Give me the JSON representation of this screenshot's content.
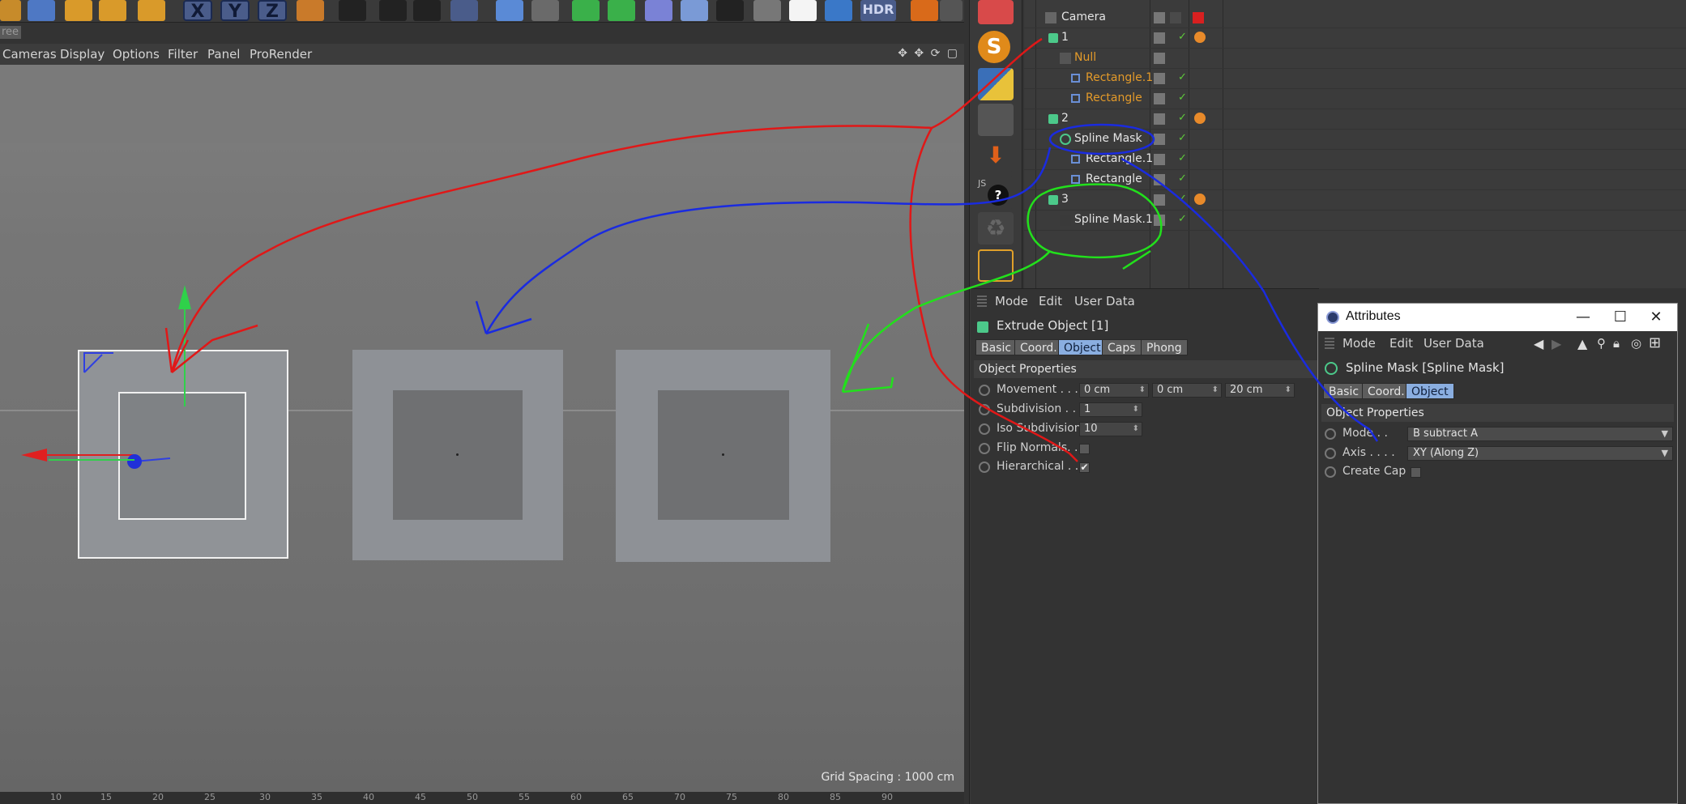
{
  "toolbar": {
    "xyz": [
      "X",
      "Y",
      "Z"
    ],
    "hdr_label": "HDR"
  },
  "tree_tab": "ree",
  "viewport": {
    "menu": [
      "Cameras",
      "Display",
      "Options",
      "Filter",
      "Panel",
      "ProRender"
    ],
    "grid_spacing": "Grid Spacing : 1000 cm",
    "ruler_ticks": [
      "10",
      "15",
      "20",
      "25",
      "30",
      "35",
      "40",
      "45",
      "50",
      "55",
      "60",
      "65",
      "70",
      "75",
      "80",
      "85",
      "90"
    ]
  },
  "palette": {
    "s_label": "S",
    "js_label": "JS",
    "help_label": "?"
  },
  "object_manager": {
    "rows": [
      {
        "name": "Camera",
        "color": "normal"
      },
      {
        "name": "1",
        "color": "normal"
      },
      {
        "name": "Null",
        "color": "orange"
      },
      {
        "name": "Rectangle.1",
        "color": "orange"
      },
      {
        "name": "Rectangle",
        "color": "orange"
      },
      {
        "name": "2",
        "color": "normal"
      },
      {
        "name": "Spline Mask",
        "color": "normal"
      },
      {
        "name": "Rectangle.1",
        "color": "normal"
      },
      {
        "name": "Rectangle",
        "color": "normal"
      },
      {
        "name": "3",
        "color": "normal"
      },
      {
        "name": "Spline Mask.1",
        "color": "normal"
      }
    ]
  },
  "attributes_left": {
    "menu": [
      "Mode",
      "Edit",
      "User Data"
    ],
    "object_title": "Extrude Object [1]",
    "tabs": [
      "Basic",
      "Coord.",
      "Object",
      "Caps",
      "Phong"
    ],
    "active_tab": "Object",
    "section": "Object Properties",
    "props": {
      "movement_label": "Movement . . .",
      "movement_x": "0 cm",
      "movement_y": "0 cm",
      "movement_z": "20 cm",
      "subdivision_label": "Subdivision . .",
      "subdivision_value": "1",
      "iso_label": "Iso Subdivision",
      "iso_value": "10",
      "flip_label": "Flip Normals. .",
      "hierarchical_label": "Hierarchical . . .",
      "hierarchical_check": "✔"
    }
  },
  "attributes_window": {
    "title": "Attributes",
    "minimize": "—",
    "maximize": "☐",
    "close": "✕",
    "menu": [
      "Mode",
      "Edit",
      "User Data"
    ],
    "object_title": "Spline Mask [Spline Mask]",
    "tabs": [
      "Basic",
      "Coord.",
      "Object"
    ],
    "active_tab": "Object",
    "section": "Object Properties",
    "mode_label": "Mode . .",
    "mode_value": "B subtract A",
    "axis_label": "Axis . . . .",
    "axis_value": "XY (Along Z)",
    "create_cap_label": "Create Cap"
  },
  "colors": {
    "accent_tab": "#8aaee0",
    "annotation_red": "#e01818",
    "annotation_blue": "#1a2be0",
    "annotation_green": "#22e01c",
    "object_orange": "#e39a2a"
  }
}
